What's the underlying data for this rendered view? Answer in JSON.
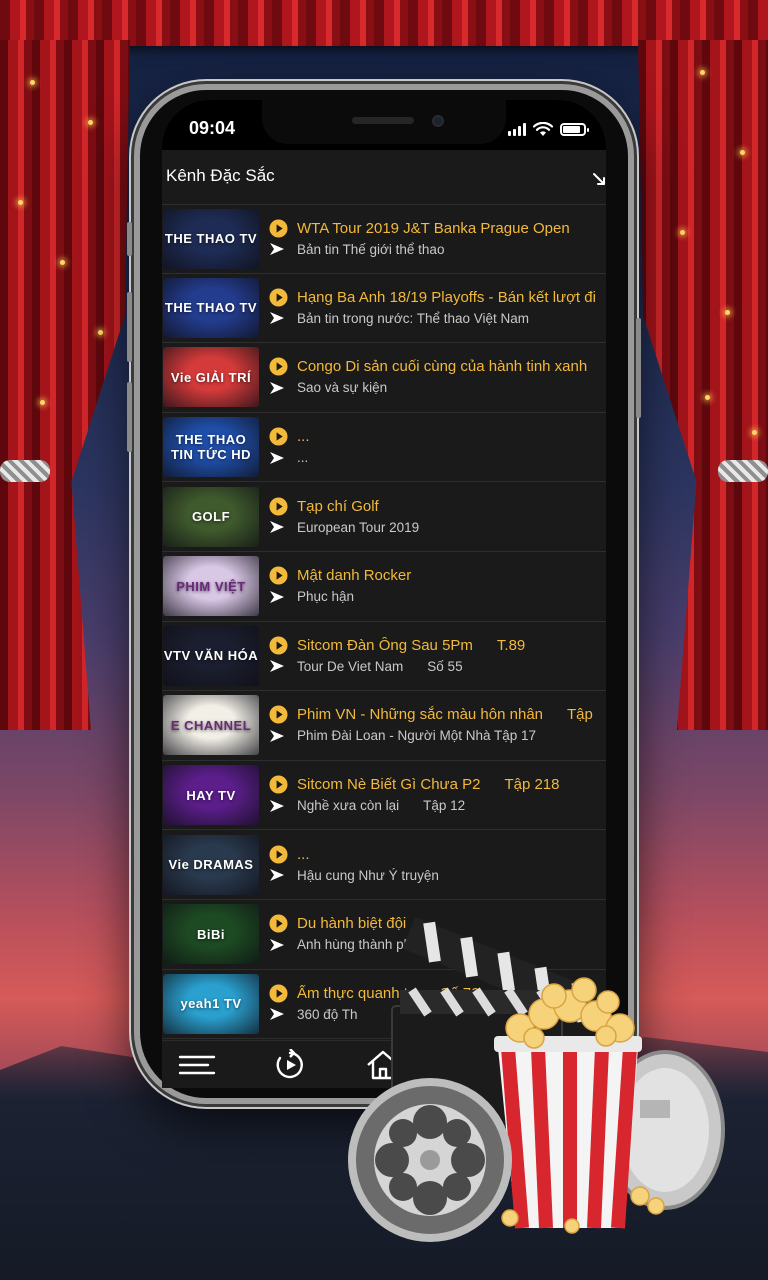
{
  "status_bar": {
    "time": "09:04"
  },
  "header": {
    "title": "Kênh Đặc Sắc"
  },
  "channels": [
    {
      "logo": "THE THAO TV",
      "thumb_bg": "#1e2c55",
      "title": "WTA Tour 2019 J&T Banka Prague Open",
      "title_tag": "",
      "subtitle": "Bản tin Thế giới thể thao",
      "subtitle_tag": ""
    },
    {
      "logo": "THE THAO TV",
      "thumb_bg": "#233c8e",
      "title": "Hạng Ba Anh 18/19 Playoffs - Bán kết lượt đi",
      "title_tag": "",
      "subtitle": "Bản tin trong nước: Thể thao Việt Nam",
      "subtitle_tag": ""
    },
    {
      "logo": "Vie GIẢI TRÍ",
      "thumb_bg": "#d53a3a",
      "title": "Congo Di sản cuối cùng của hành tinh xanh",
      "title_tag": "",
      "subtitle": "Sao và sự kiện",
      "subtitle_tag": ""
    },
    {
      "logo": "THE THAO TIN TỨC HD",
      "thumb_bg": "#1f4ea8",
      "title": "...",
      "title_tag": "",
      "subtitle": "...",
      "subtitle_tag": ""
    },
    {
      "logo": "GOLF",
      "thumb_bg": "#3f5a2c",
      "title": "Tạp chí Golf",
      "title_tag": "",
      "subtitle": "European Tour 2019",
      "subtitle_tag": ""
    },
    {
      "logo": "PHIM VIỆT",
      "thumb_bg": "#d9c7e6",
      "title": "Mật danh Rocker",
      "title_tag": "",
      "subtitle": "Phục hận",
      "subtitle_tag": ""
    },
    {
      "logo": "VTV VĂN HÓA",
      "thumb_bg": "#1b1e2e",
      "title": "Sitcom Đàn Ông Sau 5Pm",
      "title_tag": "T.89",
      "subtitle": "Tour De Viet Nam",
      "subtitle_tag": "Số 55"
    },
    {
      "logo": "E CHANNEL",
      "thumb_bg": "#f2efe7",
      "title": "Phim VN - Những sắc màu hôn nhân",
      "title_tag": "Tập",
      "subtitle": "Phim Đài Loan - Người Một Nhà Tập 17",
      "subtitle_tag": ""
    },
    {
      "logo": "HAY TV",
      "thumb_bg": "#5b1e8a",
      "title": "Sitcom Nè Biết Gì Chưa P2",
      "title_tag": "Tập 218",
      "subtitle": "Nghề xưa còn lại",
      "subtitle_tag": "Tập 12"
    },
    {
      "logo": "Vie DRAMAS",
      "thumb_bg": "#2a3a4e",
      "title": "...",
      "title_tag": "",
      "subtitle": "Hậu cung Như Ý truyện",
      "subtitle_tag": ""
    },
    {
      "logo": "BiBi",
      "thumb_bg": "#1d4a22",
      "title": "Du hành biệt đội",
      "title_tag": "",
      "subtitle": "Anh hùng thành phố",
      "subtitle_tag": ""
    },
    {
      "logo": "yeah1 TV",
      "thumb_bg": "#2aa0cf",
      "title": "Ẩm thực quanh ta",
      "title_tag": "Số 70",
      "subtitle": "360 độ Th",
      "subtitle_tag": ""
    }
  ],
  "colors": {
    "accent": "#f2b93a",
    "background": "#1a1a1a",
    "divider": "#2e2e2e"
  },
  "icons": {
    "play": "play-circle-icon",
    "arrow": "arrow-right-icon",
    "menu": "menu-icon",
    "replay": "replay-icon",
    "home": "home-icon",
    "collapse": "collapse-icon"
  }
}
